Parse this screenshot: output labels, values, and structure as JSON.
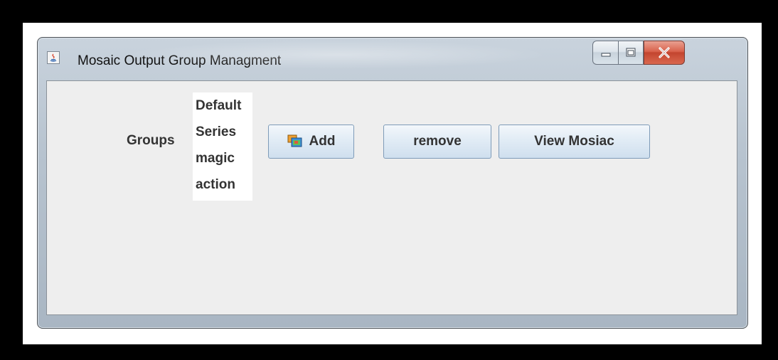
{
  "window": {
    "title": "Mosaic Output Group Managment",
    "icon": "java-app-icon",
    "controls": {
      "minimize": "minimize-icon",
      "maximize": "maximize-icon",
      "close": "close-icon"
    }
  },
  "main": {
    "groups_label": "Groups",
    "groups_list": [
      "Default",
      "Series",
      "magic",
      "action"
    ],
    "buttons": {
      "add_label": "Add",
      "add_icon": "mosaic-add-icon",
      "remove_label": "remove",
      "view_label": "View Mosiac"
    }
  },
  "colors": {
    "panel_background": "#eeeeee",
    "list_background": "#ffffff",
    "close_button": "#c94a34"
  }
}
